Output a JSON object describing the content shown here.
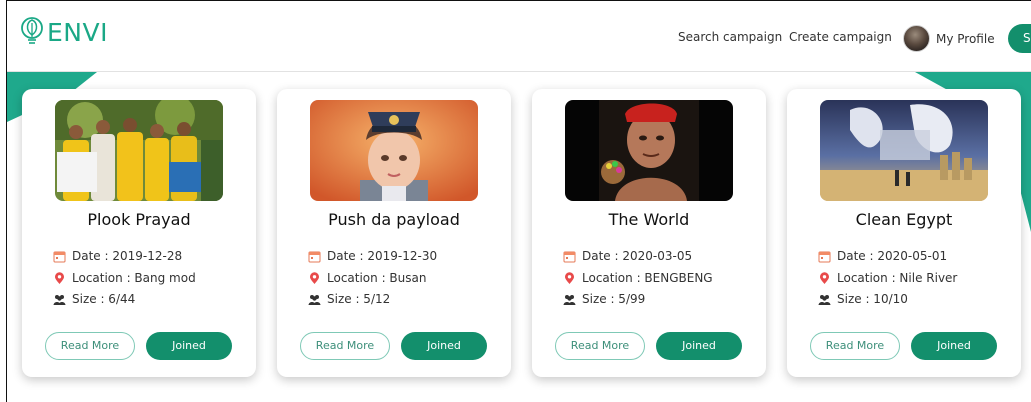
{
  "brand": {
    "name": "ENVI",
    "color": "#1aa886"
  },
  "nav": {
    "search": "Search campaign",
    "create": "Create campaign",
    "profile": "My Profile",
    "signup_partial": "S"
  },
  "accent": "#138f6c",
  "cards": [
    {
      "title": "Plook Prayad",
      "date": "Date : 2019-12-28",
      "location": "Location : Bang mod",
      "size": "Size : 6/44",
      "read_more": "Read More",
      "status": "Joined"
    },
    {
      "title": "Push da payload",
      "date": "Date : 2019-12-30",
      "location": "Location : Busan",
      "size": "Size : 5/12",
      "read_more": "Read More",
      "status": "Joined"
    },
    {
      "title": "The World",
      "date": "Date : 2020-03-05",
      "location": "Location : BENGBENG",
      "size": "Size : 5/99",
      "read_more": "Read More",
      "status": "Joined"
    },
    {
      "title": "Clean Egypt",
      "date": "Date : 2020-05-01",
      "location": "Location : Nile River",
      "size": "Size : 10/10",
      "read_more": "Read More",
      "status": "Joined"
    }
  ],
  "icons": {
    "date": "calendar-icon",
    "location": "map-pin-icon",
    "size": "people-icon"
  }
}
